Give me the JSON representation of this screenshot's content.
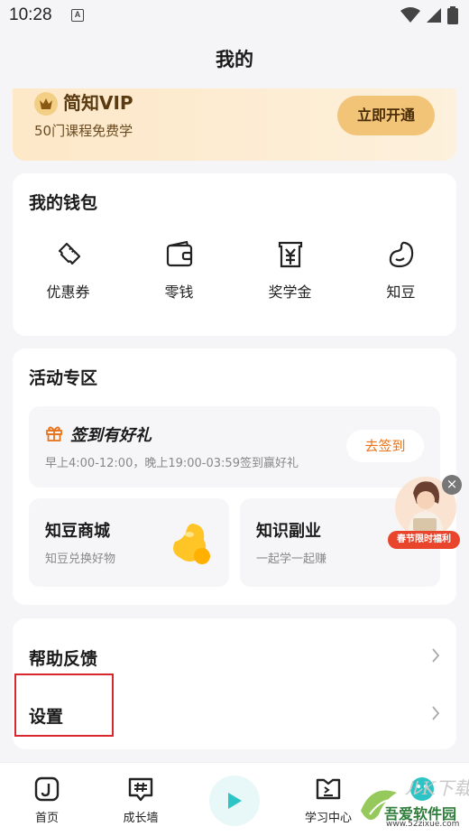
{
  "status": {
    "time": "10:28",
    "notif_icon": "A"
  },
  "header": {
    "title": "我的"
  },
  "vip": {
    "title": "简知VIP",
    "subtitle": "50门课程免费学",
    "button": "立即开通"
  },
  "wallet": {
    "title": "我的钱包",
    "items": [
      {
        "label": "优惠券",
        "icon": "coupon-icon"
      },
      {
        "label": "零钱",
        "icon": "wallet-icon"
      },
      {
        "label": "奖学金",
        "icon": "scholarship-icon"
      },
      {
        "label": "知豆",
        "icon": "bean-icon"
      }
    ]
  },
  "activity": {
    "title": "活动专区",
    "signin": {
      "title": "签到有好礼",
      "subtitle": "早上4:00-12:00，晚上19:00-03:59签到赢好礼",
      "button": "去签到"
    },
    "tiles": [
      {
        "title": "知豆商城",
        "subtitle": "知豆兑换好物"
      },
      {
        "title": "知识副业",
        "subtitle": "一起学一起赚"
      }
    ],
    "promo_label": "春节限时福利"
  },
  "settings": {
    "items": [
      {
        "label": "帮助反馈"
      },
      {
        "label": "设置"
      }
    ]
  },
  "tabbar": {
    "items": [
      {
        "label": "首页"
      },
      {
        "label": "成长墙"
      },
      {
        "label": "学习中心"
      },
      {
        "label": ""
      }
    ]
  },
  "watermark": {
    "text": "吾爱软件园",
    "url": "www.52zixue.com"
  },
  "colors": {
    "accent": "#e8731a",
    "vip_button": "#f1c477",
    "highlight": "#d8262c",
    "play": "#2cc4c4"
  }
}
